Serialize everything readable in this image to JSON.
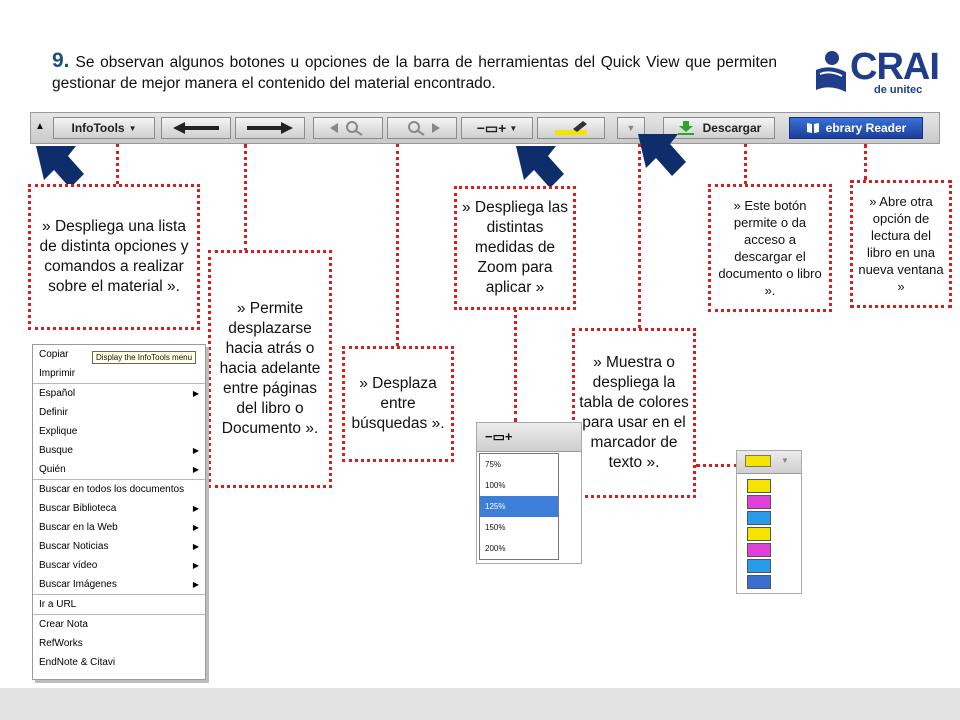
{
  "heading": {
    "number": "9.",
    "text": "Se observan algunos botones u opciones de la barra de herramientas del Quick View que permiten gestionar de mejor manera el contenido del material encontrado."
  },
  "logo": {
    "brand": "CRAI",
    "sub": "de unitec"
  },
  "toolbar": {
    "infotools_label": "InfoTools",
    "download_label": "Descargar",
    "reader_label": "ebrary Reader"
  },
  "callouts": {
    "infotools": "» Despliega una lista de distinta opciones y comandos a realizar sobre el material ».",
    "nav": "» Permite desplazarse hacia atrás o hacia adelante entre páginas del libro o Documento ».",
    "search": "» Desplaza entre búsquedas ».",
    "zoom": "» Despliega las distintas medidas de Zoom para aplicar »",
    "colors": "» Muestra o despliega la tabla de colores para usar en el marcador de texto ».",
    "download": "» Este botón permite o da acceso a descargar el documento o libro ».",
    "reader": "» Abre otra opción de lectura del libro en una nueva ventana »"
  },
  "menu": {
    "tooltip": "Display the InfoTools menu",
    "items": [
      {
        "label": "Copiar",
        "arrow": ""
      },
      {
        "label": "Imprimir",
        "arrow": ""
      },
      {
        "label": "Español",
        "arrow": "▶"
      },
      {
        "label": "Definir",
        "arrow": ""
      },
      {
        "label": "Explique",
        "arrow": ""
      },
      {
        "label": "Busque",
        "arrow": "▶"
      },
      {
        "label": "Quién",
        "arrow": "▶"
      },
      {
        "label": "Buscar en todos los documentos",
        "arrow": ""
      },
      {
        "label": "Buscar Biblioteca",
        "arrow": "▶"
      },
      {
        "label": "Buscar en la Web",
        "arrow": "▶"
      },
      {
        "label": "Buscar Noticias",
        "arrow": "▶"
      },
      {
        "label": "Buscar vídeo",
        "arrow": "▶"
      },
      {
        "label": "Buscar Imágenes",
        "arrow": "▶"
      },
      {
        "label": "Ir a URL",
        "arrow": ""
      },
      {
        "label": "Crear Nota",
        "arrow": ""
      },
      {
        "label": "RefWorks",
        "arrow": ""
      },
      {
        "label": "EndNote & Citavi",
        "arrow": ""
      }
    ]
  },
  "zoom_options": [
    "75%",
    "100%",
    "125%",
    "150%",
    "200%"
  ],
  "zoom_selected": "125%",
  "colors": {
    "accent_blue": "#0d2d6b",
    "dotted_red": "#d32020",
    "swatches": [
      "#f5e400",
      "#e040d8",
      "#2a9be8",
      "#f5e400",
      "#e040d8",
      "#2a9be8",
      "#3a6fd0"
    ]
  }
}
